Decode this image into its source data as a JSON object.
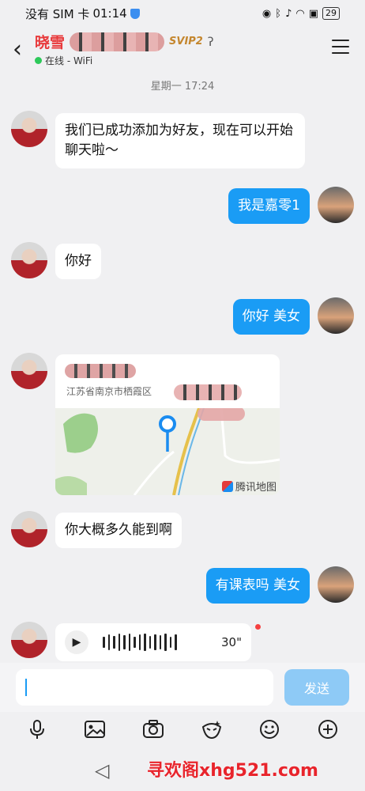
{
  "status_bar": {
    "carrier": "没有 SIM 卡",
    "time": "01:14",
    "battery": "29"
  },
  "header": {
    "name": "晓雪",
    "badge": "SVIP2",
    "online_status": "在线 - WiFi"
  },
  "chat": {
    "timestamp": "星期一 17:24",
    "messages": [
      {
        "side": "left",
        "type": "text",
        "text": "我们已成功添加为好友，现在可以开始聊天啦～"
      },
      {
        "side": "right",
        "type": "text",
        "text": "我是嘉零1"
      },
      {
        "side": "left",
        "type": "text",
        "text": "你好"
      },
      {
        "side": "right",
        "type": "text",
        "text": "你好 美女"
      },
      {
        "side": "left",
        "type": "location",
        "address": "江苏省南京市栖霞区",
        "map_credit": "腾讯地图"
      },
      {
        "side": "left",
        "type": "text",
        "text": "你大概多久能到啊"
      },
      {
        "side": "right",
        "type": "text",
        "text": "有课表吗 美女"
      },
      {
        "side": "left",
        "type": "voice",
        "duration": "30\""
      }
    ]
  },
  "input_bar": {
    "send_label": "发送"
  },
  "toolbar": {
    "icons": [
      "microphone-icon",
      "image-icon",
      "camera-icon",
      "sticker-icon",
      "emoji-icon",
      "plus-icon"
    ]
  },
  "watermark": "寻欢阁xhg521.com",
  "colors": {
    "accent": "#1a9cf5",
    "name": "#e8393b",
    "online": "#2dc95a",
    "watermark": "#e8242c"
  }
}
